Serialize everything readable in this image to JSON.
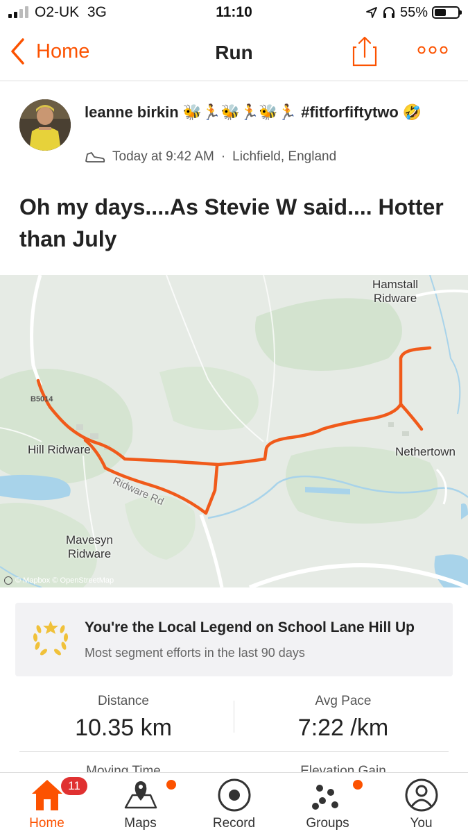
{
  "status_bar": {
    "carrier": "O2-UK",
    "network": "3G",
    "time": "11:10",
    "battery": "55%",
    "battery_level": 0.55
  },
  "nav": {
    "back_label": "Home",
    "title": "Run"
  },
  "post": {
    "athlete_name": "leanne  birkin 🐝🏃🐝🏃🐝🏃 #fitforfiftytwo 🤣",
    "timestamp": "Today at 9:42 AM",
    "separator": "·",
    "location": "Lichfield, England",
    "activity_icon": "shoe-icon",
    "title": "Oh my days....As Stevie W said.... Hotter than July"
  },
  "map": {
    "labels": {
      "hamstall": "Hamstall\nRidware",
      "hill_ridware": "Hill Ridware",
      "nethertown": "Nethertown",
      "mavesyn": "Mavesyn\nRidware",
      "road_b": "B5014",
      "ridware_rd": "Ridware Rd"
    },
    "attribution": "© Mapbox © OpenStreetMap",
    "route_color": "#f05a1a",
    "water_color": "#a8d3ea",
    "park_color": "#d6e6d2"
  },
  "legend": {
    "title": "You're the Local Legend on School Lane Hill Up",
    "subtitle": "Most segment efforts in the last 90 days",
    "icon": "laurel-icon"
  },
  "stats": {
    "distance_label": "Distance",
    "distance_value": "10.35 km",
    "pace_label": "Avg Pace",
    "pace_value": "7:22 /km",
    "moving_time_label": "Moving Time",
    "elevation_label": "Elevation Gain"
  },
  "tabs": [
    {
      "label": "Home",
      "icon": "home-icon",
      "badge": "11",
      "active": true
    },
    {
      "label": "Maps",
      "icon": "map-icon",
      "dot": true
    },
    {
      "label": "Record",
      "icon": "record-icon"
    },
    {
      "label": "Groups",
      "icon": "groups-icon",
      "dot": true
    },
    {
      "label": "You",
      "icon": "profile-icon"
    }
  ],
  "colors": {
    "accent": "#fc5200",
    "badge": "#e03131"
  }
}
